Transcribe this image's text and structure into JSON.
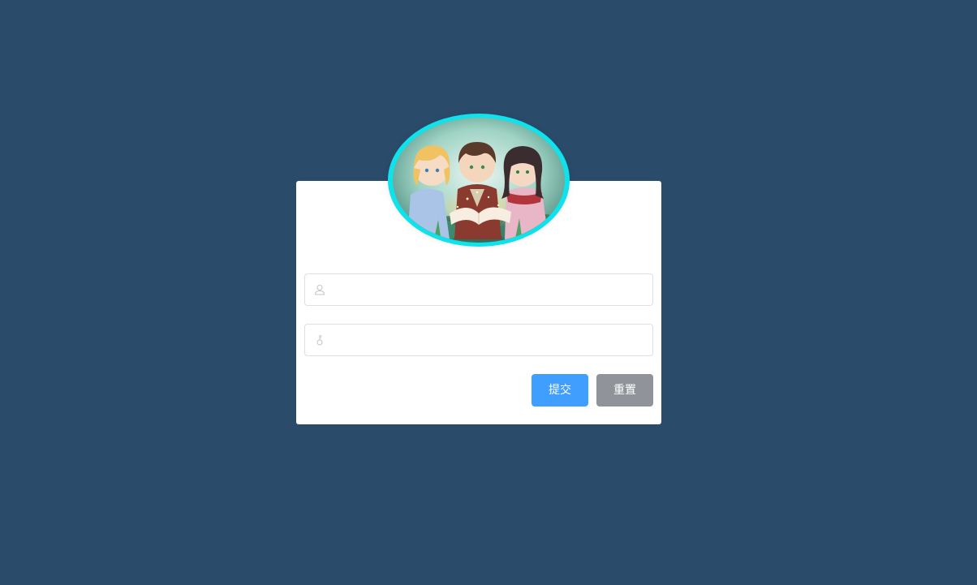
{
  "avatar": {
    "icon": "avatar-illustration"
  },
  "form": {
    "username": {
      "value": "",
      "placeholder": "",
      "icon": "user-icon"
    },
    "password": {
      "value": "",
      "placeholder": "",
      "icon": "key-icon"
    }
  },
  "buttons": {
    "submit_label": "提交",
    "reset_label": "重置"
  },
  "colors": {
    "background": "#2b4b6b",
    "avatar_ring": "#0fe2ea",
    "primary": "#409eff",
    "info": "#909399"
  }
}
